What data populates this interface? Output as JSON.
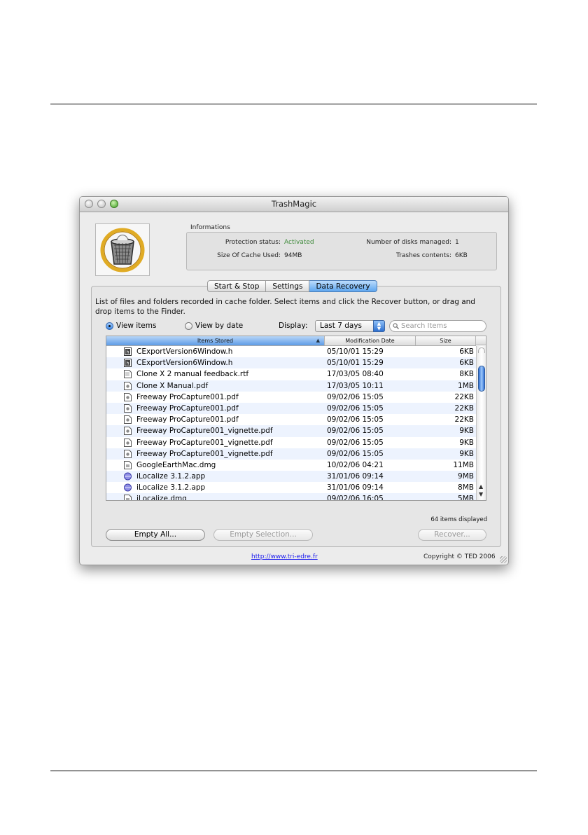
{
  "window": {
    "title": "TrashMagic",
    "icon": "trash-basket-icon"
  },
  "info": {
    "group_title": "Informations",
    "protection_label": "Protection status:",
    "protection_value": "Activated",
    "disks_label": "Number of disks managed:",
    "disks_value": "1",
    "cache_label": "Size Of Cache Used:",
    "cache_value": "94MB",
    "trashes_label": "Trashes contents:",
    "trashes_value": "6KB"
  },
  "tabs": [
    {
      "label": "Start & Stop",
      "active": false
    },
    {
      "label": "Settings",
      "active": false
    },
    {
      "label": "Data Recovery",
      "active": true
    }
  ],
  "description": "List of files and folders recorded in cache folder. Select items and click the Recover button, or drag and drop items to the Finder.",
  "view": {
    "items_label": "View items",
    "date_label": "View by date",
    "selected": "items"
  },
  "display": {
    "label": "Display:",
    "value": "Last 7 days"
  },
  "search": {
    "placeholder": "Search Items"
  },
  "table": {
    "columns": [
      "Items Stored",
      "Modification Date",
      "Size"
    ],
    "sorted_column": "Items Stored",
    "rows": [
      {
        "name": "CExportVersion6Window.h",
        "date": "05/10/01 15:29",
        "size": "6KB",
        "icon": "header-file-icon"
      },
      {
        "name": "CExportVersion6Window.h",
        "date": "05/10/01 15:29",
        "size": "6KB",
        "icon": "header-file-icon"
      },
      {
        "name": "Clone X 2 manual feedback.rtf",
        "date": "17/03/05 08:40",
        "size": "8KB",
        "icon": "rtf-file-icon"
      },
      {
        "name": "Clone X Manual.pdf",
        "date": "17/03/05 10:11",
        "size": "1MB",
        "icon": "pdf-file-icon"
      },
      {
        "name": "Freeway ProCapture001.pdf",
        "date": "09/02/06 15:05",
        "size": "22KB",
        "icon": "pdf-file-icon"
      },
      {
        "name": "Freeway ProCapture001.pdf",
        "date": "09/02/06 15:05",
        "size": "22KB",
        "icon": "pdf-file-icon"
      },
      {
        "name": "Freeway ProCapture001.pdf",
        "date": "09/02/06 15:05",
        "size": "22KB",
        "icon": "pdf-file-icon"
      },
      {
        "name": "Freeway ProCapture001_vignette.pdf",
        "date": "09/02/06 15:05",
        "size": "9KB",
        "icon": "pdf-file-icon"
      },
      {
        "name": "Freeway ProCapture001_vignette.pdf",
        "date": "09/02/06 15:05",
        "size": "9KB",
        "icon": "pdf-file-icon"
      },
      {
        "name": "Freeway ProCapture001_vignette.pdf",
        "date": "09/02/06 15:05",
        "size": "9KB",
        "icon": "pdf-file-icon"
      },
      {
        "name": "GoogleEarthMac.dmg",
        "date": "10/02/06 04:21",
        "size": "11MB",
        "icon": "disk-image-icon"
      },
      {
        "name": "iLocalize 3.1.2.app",
        "date": "31/01/06 09:14",
        "size": "9MB",
        "icon": "application-icon"
      },
      {
        "name": "iLocalize 3.1.2.app",
        "date": "31/01/06 09:14",
        "size": "8MB",
        "icon": "application-icon"
      },
      {
        "name": "iLocalize.dmg",
        "date": "09/02/06 16:05",
        "size": "5MB",
        "icon": "disk-image-icon"
      }
    ]
  },
  "items_count": "64 items displayed",
  "buttons": {
    "empty_all": "Empty All...",
    "empty_selection": "Empty Selection...",
    "recover": "Recover..."
  },
  "footer": {
    "link": "http://www.tri-edre.fr",
    "copyright": "Copyright © TED 2006"
  }
}
